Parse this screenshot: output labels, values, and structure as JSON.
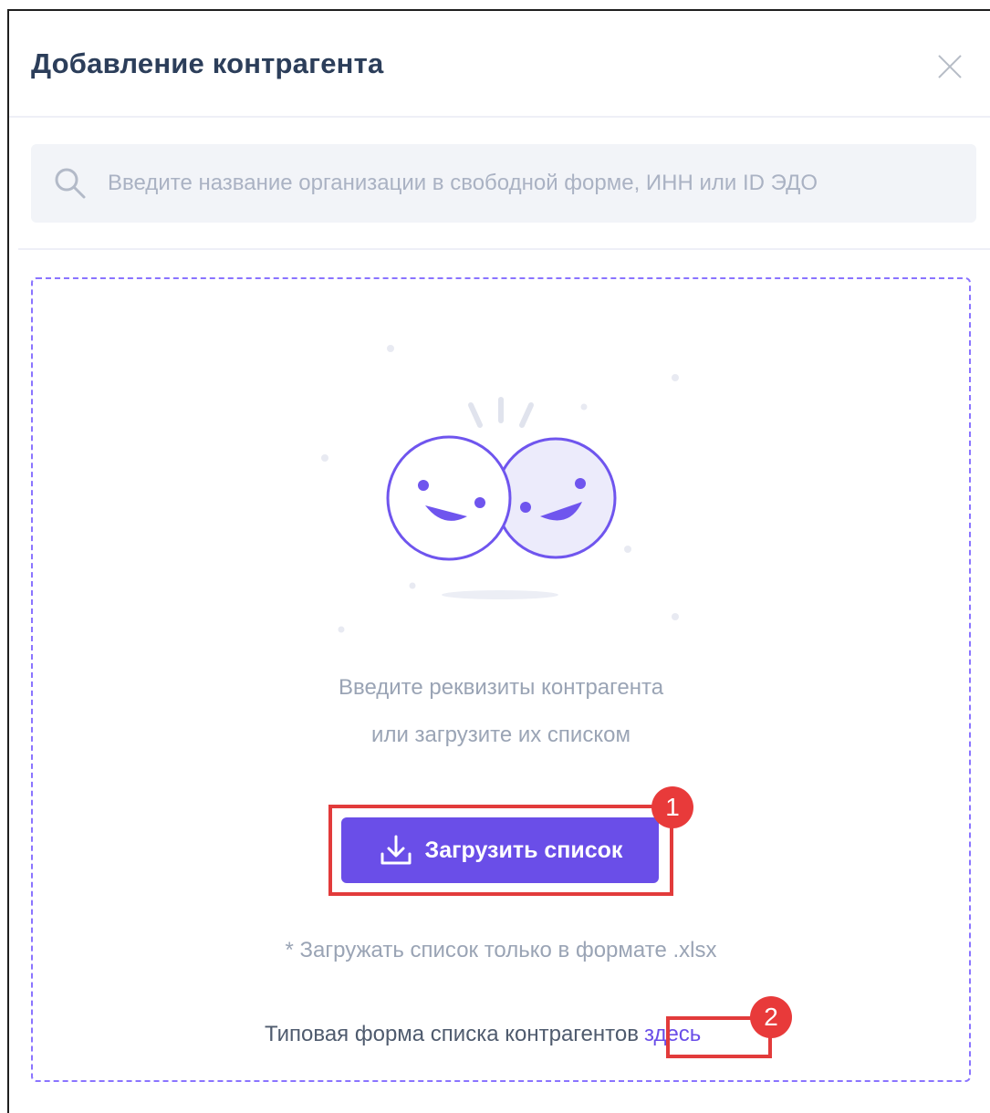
{
  "modal": {
    "title": "Добавление контрагента"
  },
  "search": {
    "placeholder": "Введите название организации в свободной форме, ИНН или ID ЭДО",
    "value": ""
  },
  "dropzone": {
    "hint_line1": "Введите реквизиты контрагента",
    "hint_line2": "или загрузите их списком",
    "upload_label": "Загрузить список",
    "format_note": "* Загружать список только в формате .xlsx",
    "template_text": "Типовая форма списка контрагентов",
    "template_link": "здесь"
  },
  "annotations": [
    {
      "number": "1"
    },
    {
      "number": "2"
    }
  ],
  "icons": {
    "close": "close-icon",
    "search": "search-icon",
    "illustration": "smiley-faces-illustration",
    "download": "download-icon"
  },
  "colors": {
    "accent": "#6a4ee8",
    "title": "#2c3e5a",
    "muted_text": "#9aa4b5",
    "search_bg": "#f2f4f8",
    "dropzone_border": "#8a74ff",
    "annotation": "#e23b3b"
  }
}
